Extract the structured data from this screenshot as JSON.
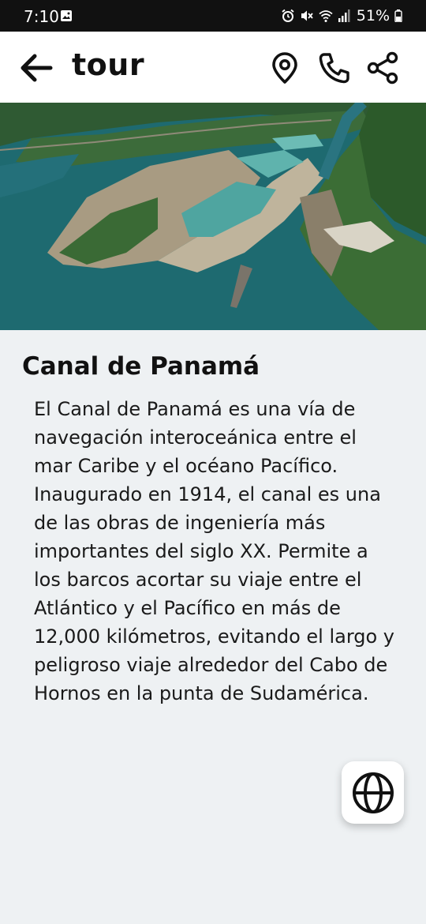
{
  "status_bar": {
    "time": "7:10",
    "battery": "51%"
  },
  "app_bar": {
    "title": "tour",
    "icons": [
      "arrow-left-icon",
      "location-pin-icon",
      "phone-icon",
      "share-icon"
    ]
  },
  "article": {
    "title": "Canal de Panamá",
    "description": "El Canal de Panamá es una vía de navegación interoceánica entre el mar Caribe y el océano Pacífico. Inaugurado en 1914, el canal es una de las obras de ingeniería más importantes del siglo XX. Permite a los barcos acortar su viaje entre el Atlántico y el Pacífico en más de 12,000 kilómetros, evitando el largo y peligroso viaje alrededor del Cabo de Hornos en la punta de Sudamérica."
  },
  "fab": {
    "icon": "globe-icon"
  },
  "colors": {
    "status_bar_bg": "#111111",
    "app_bar_bg": "#ffffff",
    "page_bg": "#eef1f3",
    "water": "#1f6f73"
  }
}
